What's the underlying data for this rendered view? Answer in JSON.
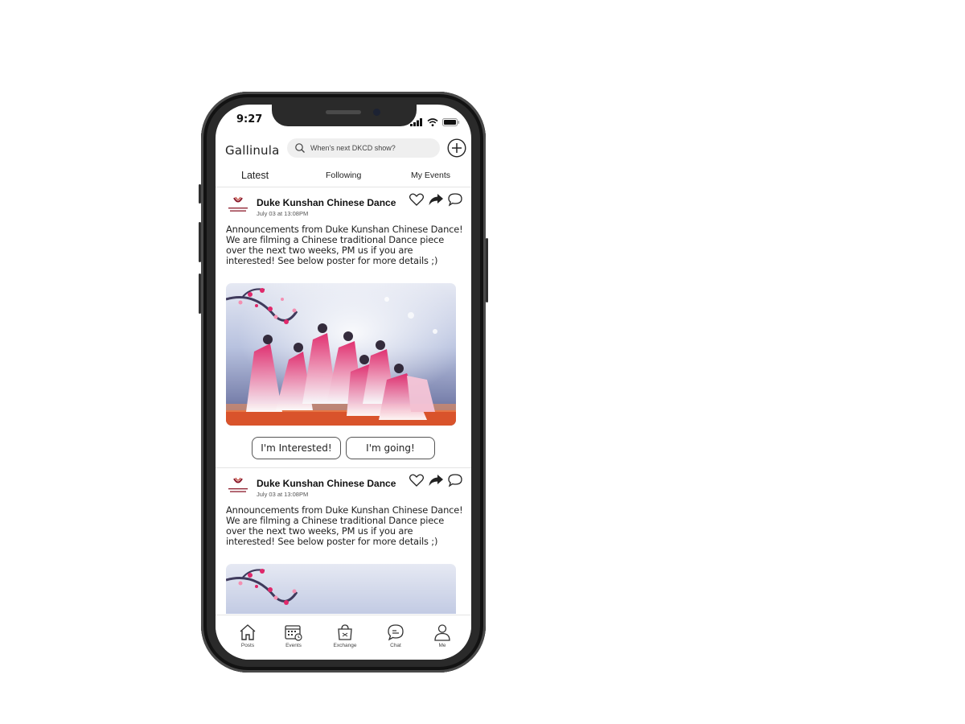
{
  "status_bar": {
    "time": "9:27"
  },
  "app": {
    "logo": "Gallinula"
  },
  "search": {
    "placeholder": "When's next DKCD show?"
  },
  "tabs": [
    {
      "label": "Latest",
      "active": true
    },
    {
      "label": "Following",
      "active": false
    },
    {
      "label": "My Events",
      "active": false
    }
  ],
  "posts": [
    {
      "org_name": "Duke Kunshan Chinese Dance",
      "date": "July 03 at 13:08PM",
      "text": "Announcements from Duke Kunshan Chinese Dance! We are filming a Chinese traditional Dance piece over the next two weeks, PM us if you are interested! See below poster for more details ;)",
      "interested_label": "I'm Interested!",
      "going_label": "I'm going!"
    },
    {
      "org_name": "Duke Kunshan Chinese Dance",
      "date": "July 03 at 13:08PM",
      "text": "Announcements from Duke Kunshan Chinese Dance! We are filming a Chinese traditional Dance piece over the next two weeks, PM us if you are interested! See below poster for more details ;)"
    }
  ],
  "bottom_nav": [
    {
      "label": "Posts",
      "icon": "home-icon"
    },
    {
      "label": "Events",
      "icon": "calendar-icon"
    },
    {
      "label": "Exchange",
      "icon": "shopping-bag-icon"
    },
    {
      "label": "Chat",
      "icon": "chat-bubble-icon"
    },
    {
      "label": "Me",
      "icon": "person-icon"
    }
  ],
  "colors": {
    "accent": "#e0286a",
    "brand_red": "#8b1a2b",
    "search_bg": "#efefef"
  }
}
